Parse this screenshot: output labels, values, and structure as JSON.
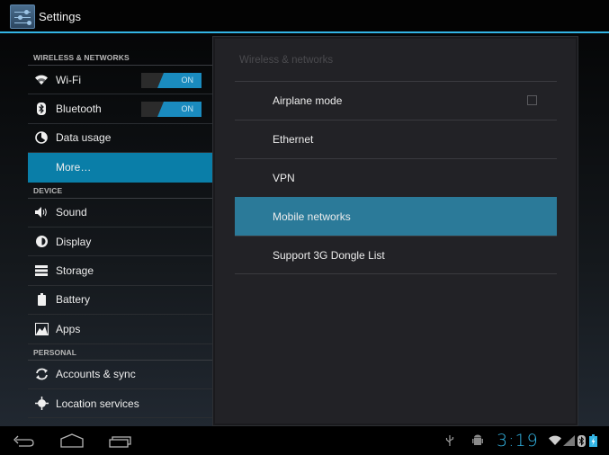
{
  "app": {
    "title": "Settings",
    "icon": "settings-sliders-icon",
    "accent_color": "#33b5e5"
  },
  "headers": {
    "sections": [
      {
        "category": "WIRELESS & NETWORKS",
        "items": [
          {
            "label": "Wi-Fi",
            "icon": "wifi-icon",
            "toggle": "ON"
          },
          {
            "label": "Bluetooth",
            "icon": "bluetooth-icon",
            "toggle": "ON"
          },
          {
            "label": "Data usage",
            "icon": "data-usage-icon"
          },
          {
            "label": "More…",
            "icon": "",
            "selected": true
          }
        ]
      },
      {
        "category": "DEVICE",
        "items": [
          {
            "label": "Sound",
            "icon": "speaker-icon"
          },
          {
            "label": "Display",
            "icon": "brightness-icon"
          },
          {
            "label": "Storage",
            "icon": "storage-icon"
          },
          {
            "label": "Battery",
            "icon": "battery-icon"
          },
          {
            "label": "Apps",
            "icon": "apps-icon"
          }
        ]
      },
      {
        "category": "PERSONAL",
        "items": [
          {
            "label": "Accounts & sync",
            "icon": "sync-icon"
          },
          {
            "label": "Location services",
            "icon": "location-icon"
          }
        ]
      }
    ]
  },
  "detail": {
    "title": "Wireless & networks",
    "items": [
      {
        "label": "Airplane mode",
        "checkbox": false
      },
      {
        "label": "Ethernet"
      },
      {
        "label": "VPN"
      },
      {
        "label": "Mobile networks",
        "selected": true
      },
      {
        "label": "Support 3G Dongle List"
      }
    ]
  },
  "navbar": {
    "buttons": [
      "back-icon",
      "home-icon",
      "recent-apps-icon"
    ]
  },
  "statusbar": {
    "time": "3:19",
    "icons": [
      "usb-icon",
      "android-debug-icon",
      "wifi-signal-icon",
      "cell-signal-icon",
      "bluetooth-icon",
      "battery-charging-icon"
    ]
  }
}
